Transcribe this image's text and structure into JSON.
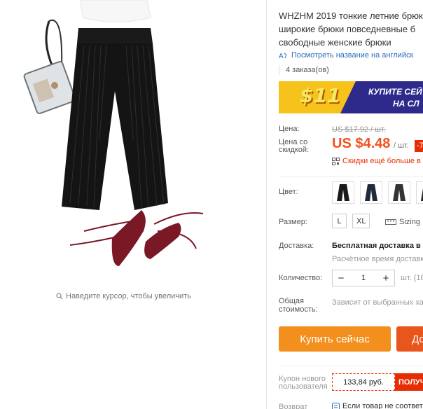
{
  "gallery": {
    "zoom_hint": "Наведите курсор, чтобы увеличить"
  },
  "product": {
    "title_lines": [
      "WHZHM 2019 тонкие летние брюк",
      "широкие брюки повседневные б",
      "свободные женские брюки"
    ],
    "translate_link": "Посмотреть название на английск",
    "orders": "4 заказа(ов)"
  },
  "banner": {
    "amount": "$11",
    "line1": "КУПИТЕ СЕЙ",
    "line2": "НА СЛ",
    "colors": {
      "background": "#2d2a8c",
      "accent": "#f6c21c"
    }
  },
  "price": {
    "label": "Цена:",
    "old": "US $17.92 / шт.",
    "discount_label_1": "Цена со",
    "discount_label_2": "скидкой:",
    "new": "US $4.48",
    "unit": "/ шт.",
    "badge": "-7",
    "more_discounts": "Скидки ещё больше в",
    "accent_color": "#f4511e"
  },
  "sku": {
    "color_label": "Цвет:",
    "colors": [
      "black-pants",
      "black-pants",
      "black-pants",
      "black-pants"
    ],
    "size_label": "Размер:",
    "sizes": [
      "L",
      "XL"
    ],
    "sizing_link": "Sizing I"
  },
  "shipping": {
    "label": "Доставка:",
    "free": "Бесплатная доставка в I",
    "estimate": "Расчётное время доставк"
  },
  "quantity": {
    "label": "Количество:",
    "minus": "−",
    "value": "1",
    "plus": "+",
    "unit": "шт. (18"
  },
  "total": {
    "label_1": "Общая",
    "label_2": "стоимость:",
    "text": "Зависит от выбранных ха"
  },
  "actions": {
    "buy_now": "Купить сейчас",
    "add_to_cart": "До",
    "buy_color": "#f38f1d",
    "cart_color": "#e8561e"
  },
  "coupon": {
    "label_1": "Купон нового",
    "label_2": "пользователя",
    "value": "133,84 руб.",
    "get": "ПОЛУЧ"
  },
  "returns": {
    "label": "Возврат",
    "text": "Если товар не соответ"
  }
}
